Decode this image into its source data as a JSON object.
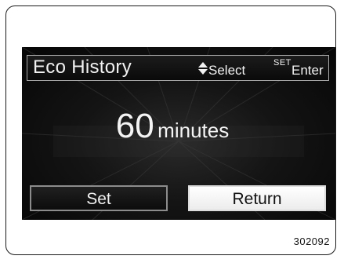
{
  "header": {
    "title": "Eco History",
    "select_hint": "Select",
    "set_key": "SET",
    "enter_hint": "Enter",
    "select_icon": "up-down-arrows-icon"
  },
  "value": {
    "number": "60",
    "unit": "minutes"
  },
  "buttons": {
    "set_label": "Set",
    "return_label": "Return"
  },
  "figure_id": "302092",
  "colors": {
    "screen_background": "#0a0a0a",
    "text": "#f2f2f2",
    "selected_button": "#ffffff"
  }
}
